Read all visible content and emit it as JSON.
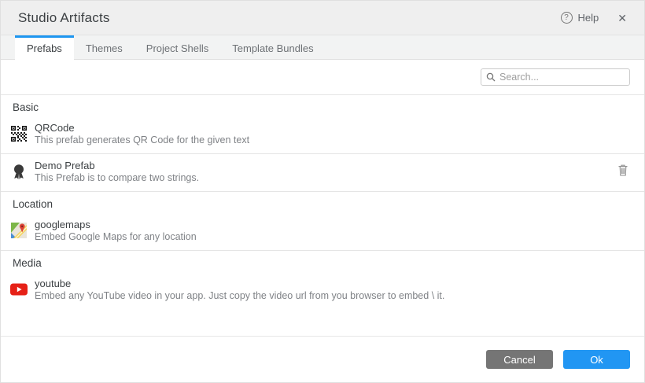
{
  "dialog": {
    "title": "Studio Artifacts"
  },
  "header": {
    "help_label": "Help",
    "help_icon": "?",
    "close_icon": "✕"
  },
  "tabs": [
    {
      "label": "Prefabs",
      "active": true
    },
    {
      "label": "Themes",
      "active": false
    },
    {
      "label": "Project Shells",
      "active": false
    },
    {
      "label": "Template Bundles",
      "active": false
    }
  ],
  "search": {
    "placeholder": "Search..."
  },
  "sections": [
    {
      "title": "Basic",
      "items": [
        {
          "icon": "qrcode-icon",
          "name": "QRCode",
          "description": "This prefab generates QR Code for the given text"
        },
        {
          "icon": "ribbon-icon",
          "name": "Demo Prefab",
          "description": "This Prefab is to compare two strings.",
          "deletable": true
        }
      ]
    },
    {
      "title": "Location",
      "items": [
        {
          "icon": "googlemaps-icon",
          "name": "googlemaps",
          "description": "Embed Google Maps for any location"
        }
      ]
    },
    {
      "title": "Media",
      "items": [
        {
          "icon": "youtube-icon",
          "name": "youtube",
          "description": "Embed any YouTube video in your app. Just copy the video url from you browser to embed \\ it."
        }
      ]
    }
  ],
  "footer": {
    "cancel_label": "Cancel",
    "ok_label": "Ok"
  },
  "colors": {
    "accent": "#2196f3",
    "cancel": "#757575",
    "tab_indicator": "#1e96f0",
    "youtube_red": "#e62117"
  }
}
